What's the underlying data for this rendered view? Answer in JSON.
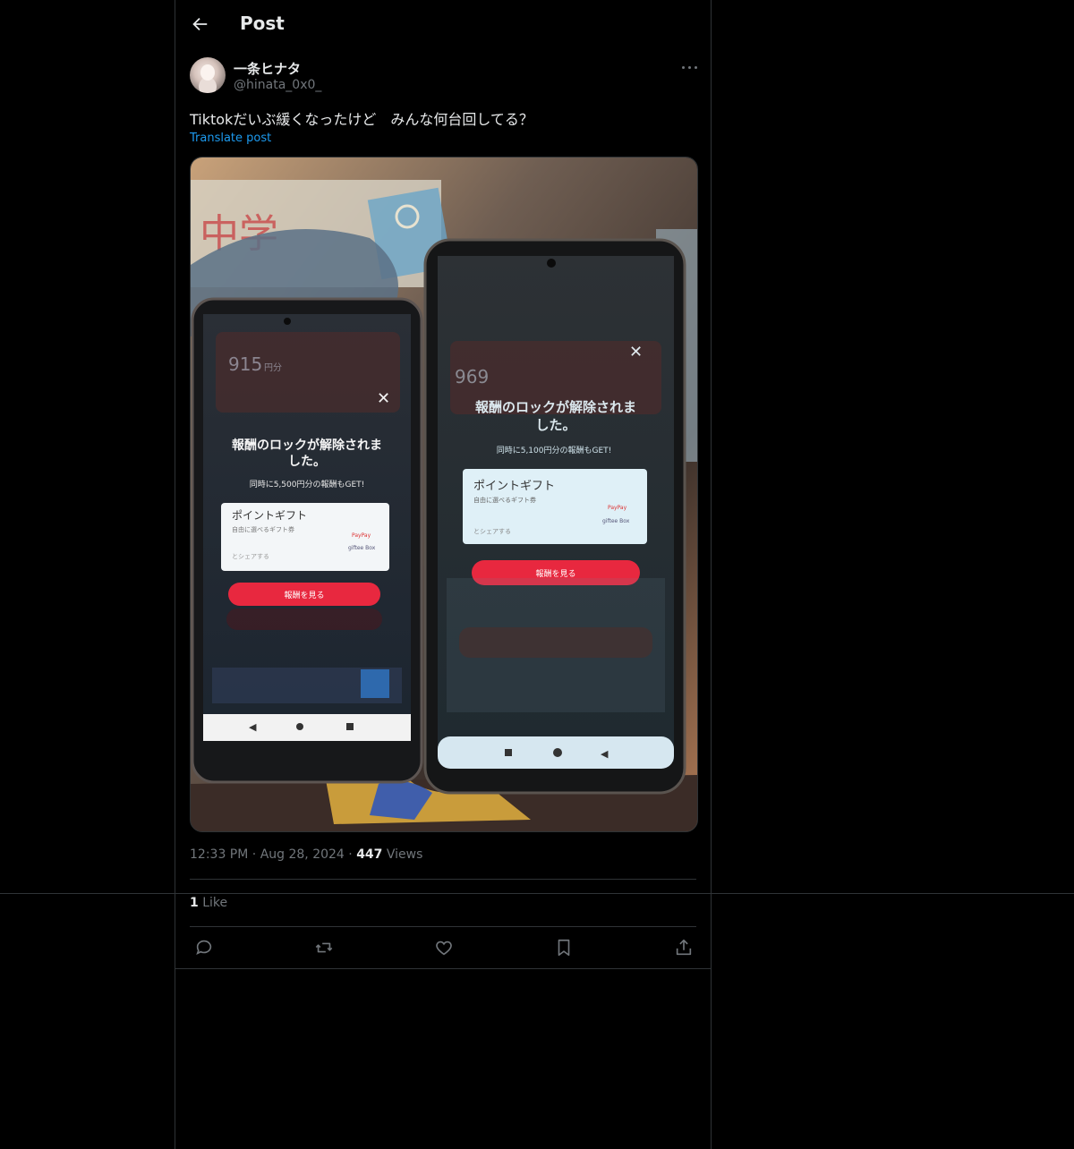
{
  "header": {
    "title": "Post"
  },
  "author": {
    "name": "一条ヒナタ",
    "handle": "@hinata_0x0_"
  },
  "post": {
    "text": "Tiktokだいぶ緩くなったけど　みんな何台回してる？",
    "translate_label": "Translate post"
  },
  "photo": {
    "left_phone": {
      "balance": "915",
      "unit": "円分",
      "headline_1": "報酬のロックが解除されま",
      "headline_2": "した。",
      "subline": "同時に5,500円分の報酬もGET!",
      "card_title": "ポイントギフト",
      "card_sub": "自由に選べるギフト券",
      "card_share": "とシェアする",
      "button": "報酬を見る",
      "paypay": "PayPay",
      "giftee": "giftee Box"
    },
    "right_phone": {
      "balance": "969",
      "headline_1": "報酬のロックが解除されま",
      "headline_2": "した。",
      "subline": "同時に5,100円分の報酬もGET!",
      "card_title": "ポイントギフト",
      "card_sub": "自由に選べるギフト券",
      "card_share": "とシェアする",
      "button": "報酬を見る",
      "paypay": "PayPay",
      "giftee": "giftee Box"
    }
  },
  "meta": {
    "time": "12:33 PM",
    "sep": "·",
    "date": "Aug 28, 2024",
    "views_count": "447",
    "views_label": "Views"
  },
  "likes": {
    "count": "1",
    "label": "Like"
  },
  "colors": {
    "accent": "#1d9bf0",
    "muted": "#71767b",
    "border": "#2f3336",
    "button_red": "#e8283f"
  },
  "icons": [
    "back-arrow-icon",
    "more-icon",
    "reply-icon",
    "repost-icon",
    "like-icon",
    "bookmark-icon",
    "share-icon"
  ]
}
